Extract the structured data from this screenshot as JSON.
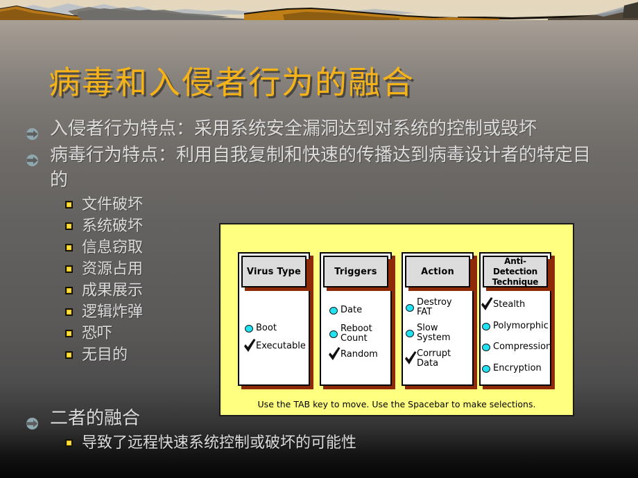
{
  "slide": {
    "title": "病毒和入侵者行为的融合",
    "title_color": "#f5b317",
    "background_top_color": "#b0a79c",
    "background_bottom_color": "#050505"
  },
  "body": {
    "bullet_level1_icon": "arrow-circle-bullet",
    "bullet_level2_icon": "yellow-square-bullet",
    "items": [
      {
        "level": 1,
        "text": "入侵者行为特点：采用系统安全漏洞达到对系统的控制或毁坏"
      },
      {
        "level": 1,
        "text": "病毒行为特点：利用自我复制和快速的传播达到病毒设计者的特定目的"
      }
    ],
    "sub_items": [
      {
        "text": "文件破坏"
      },
      {
        "text": "系统破坏"
      },
      {
        "text": "信息窃取"
      },
      {
        "text": "资源占用"
      },
      {
        "text": "成果展示"
      },
      {
        "text": "逻辑炸弹"
      },
      {
        "text": "恐吓"
      },
      {
        "text": "无目的"
      }
    ],
    "tail_items": [
      {
        "level": 1,
        "text": "二者的融合"
      },
      {
        "level": 2,
        "text": "导致了远程快速系统控制或破坏的可能性"
      }
    ]
  },
  "diagram": {
    "background_color": "#ffff80",
    "header_fill": "#dcdcdc",
    "shadow_color": "#8f2a08",
    "dot_color": "#22e2f2",
    "caption": "Use the TAB key to move.  Use the Spacebar to make selections.",
    "columns": [
      {
        "header": "Virus\nType",
        "items": [
          {
            "label": "Boot",
            "marker": "dot"
          },
          {
            "label": "Executable",
            "marker": "check"
          }
        ]
      },
      {
        "header": "Triggers",
        "items": [
          {
            "label": "Date",
            "marker": "dot"
          },
          {
            "label": "Reboot\nCount",
            "marker": "dot"
          },
          {
            "label": "Random",
            "marker": "check"
          }
        ]
      },
      {
        "header": "Action",
        "items": [
          {
            "label": "Destroy\nFAT",
            "marker": "dot"
          },
          {
            "label": "Slow\nSystem",
            "marker": "dot"
          },
          {
            "label": "Corrupt\nData",
            "marker": "check"
          }
        ]
      },
      {
        "header": "Anti-Detection\nTechnique",
        "items": [
          {
            "label": "Stealth",
            "marker": "check"
          },
          {
            "label": "Polymorphic",
            "marker": "dot"
          },
          {
            "label": "Compression",
            "marker": "dot"
          },
          {
            "label": "Encryption",
            "marker": "dot"
          }
        ]
      }
    ]
  }
}
